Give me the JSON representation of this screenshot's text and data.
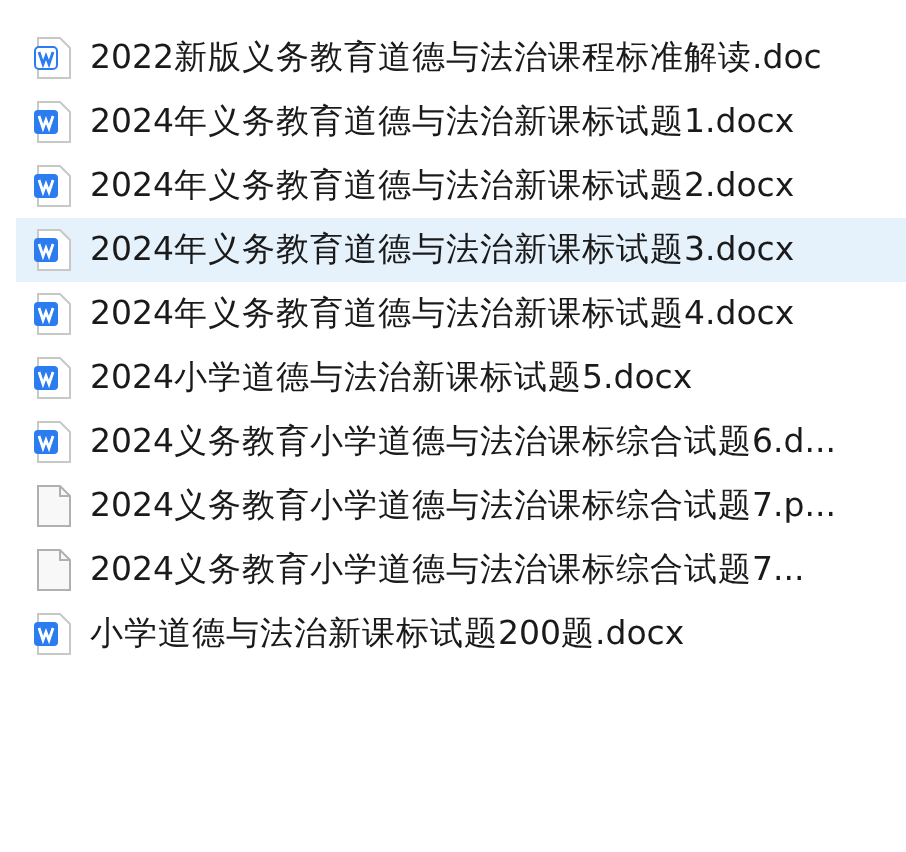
{
  "files": [
    {
      "name": "2022新版义务教育道德与法治课程标准解读.doc",
      "kind": "doc",
      "selected": false
    },
    {
      "name": "2024年义务教育道德与法治新课标试题1.docx",
      "kind": "docx",
      "selected": false
    },
    {
      "name": "2024年义务教育道德与法治新课标试题2.docx",
      "kind": "docx",
      "selected": false
    },
    {
      "name": "2024年义务教育道德与法治新课标试题3.docx",
      "kind": "docx",
      "selected": true
    },
    {
      "name": "2024年义务教育道德与法治新课标试题4.docx",
      "kind": "docx",
      "selected": false
    },
    {
      "name": "2024小学道德与法治新课标试题5.docx",
      "kind": "docx",
      "selected": false
    },
    {
      "name": "2024义务教育小学道德与法治课标综合试题6.d...",
      "kind": "docx",
      "selected": false
    },
    {
      "name": "2024义务教育小学道德与法治课标综合试题7.p...",
      "kind": "blank",
      "selected": false
    },
    {
      "name": "2024义务教育小学道德与法治课标综合试题7...",
      "kind": "blank",
      "selected": false
    },
    {
      "name": "小学道德与法治新课标试题200题.docx",
      "kind": "docx",
      "selected": false
    }
  ]
}
